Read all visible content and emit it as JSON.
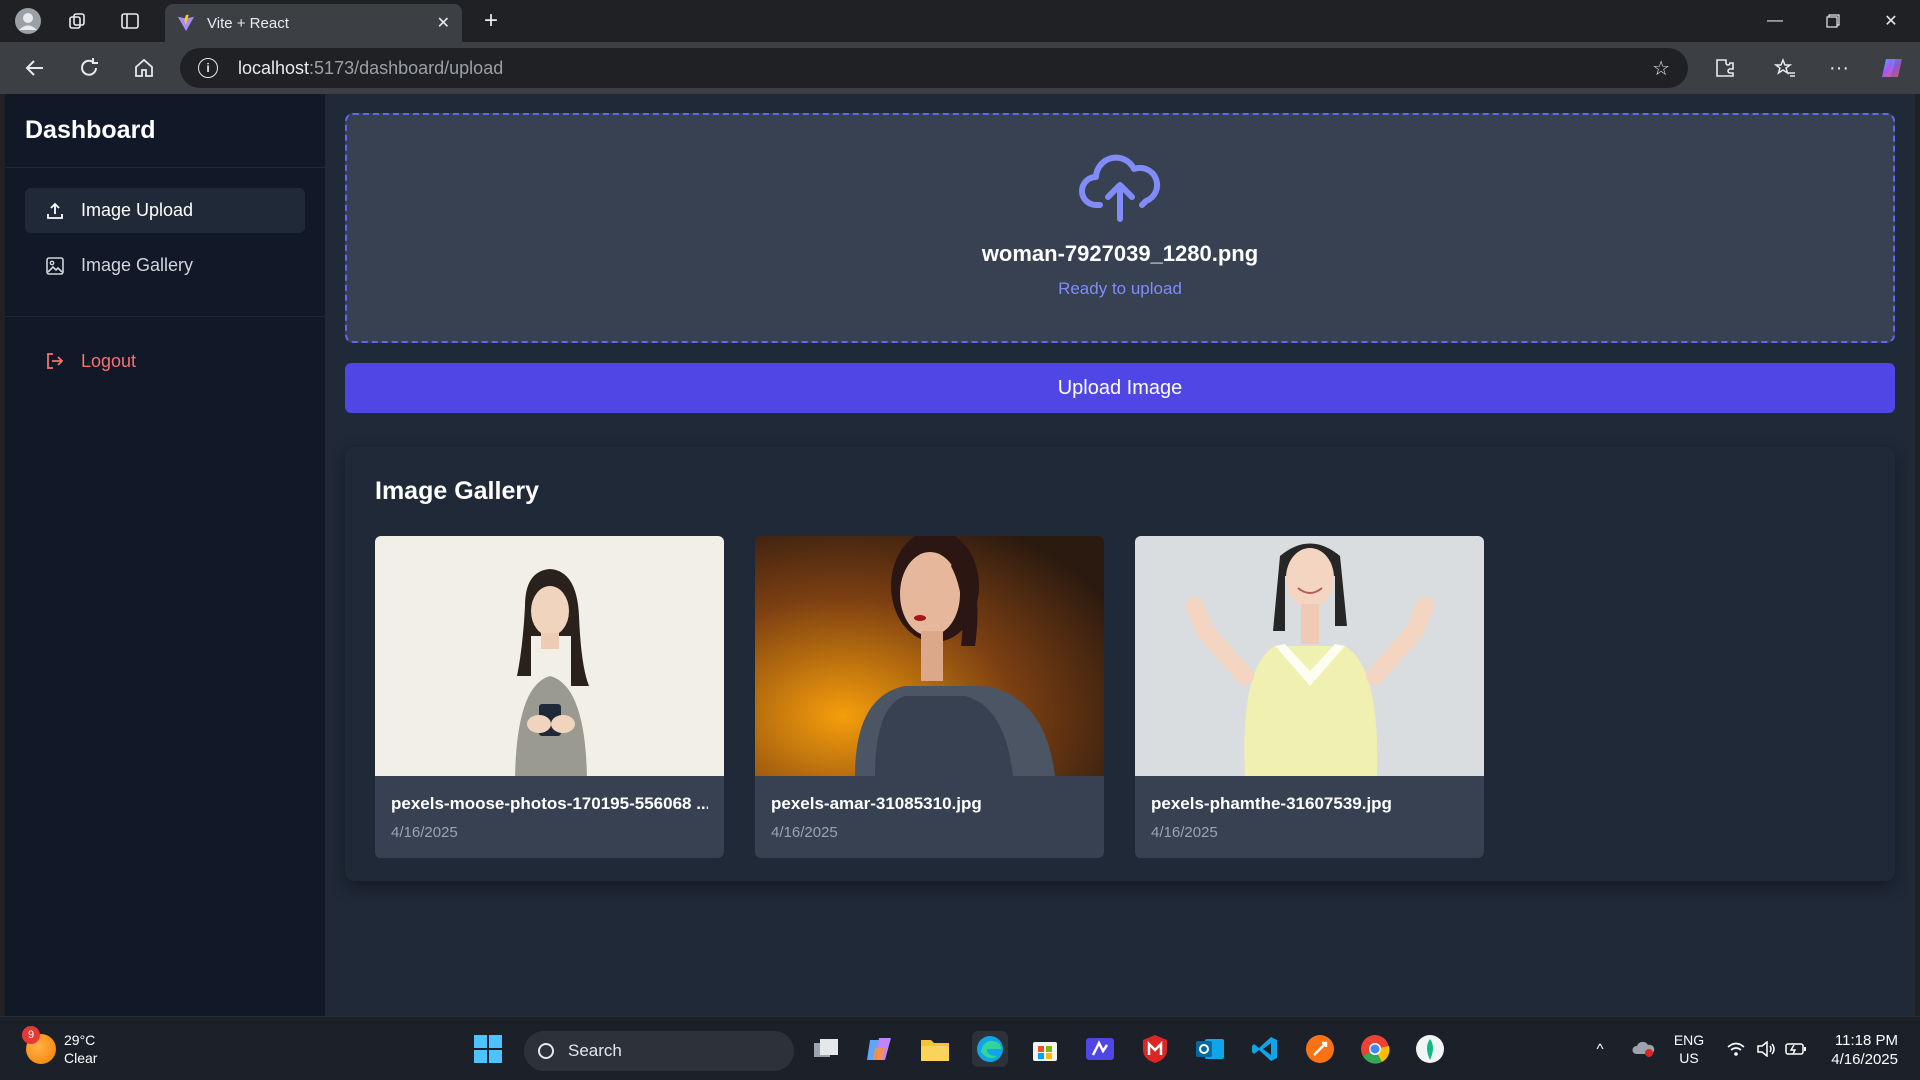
{
  "browser": {
    "tab_title": "Vite + React",
    "url_host": "localhost",
    "url_path": ":5173/dashboard/upload"
  },
  "sidebar": {
    "brand": "Dashboard",
    "items": [
      {
        "label": "Image Upload",
        "icon": "upload-icon",
        "active": true
      },
      {
        "label": "Image Gallery",
        "icon": "image-icon",
        "active": false
      }
    ],
    "logout_label": "Logout"
  },
  "upload": {
    "file_name": "woman-7927039_1280.png",
    "status": "Ready to upload",
    "button_label": "Upload Image"
  },
  "gallery": {
    "title": "Image Gallery",
    "images": [
      {
        "name": "pexels-moose-photos-170195-556068 ...",
        "date": "4/16/2025"
      },
      {
        "name": "pexels-amar-31085310.jpg",
        "date": "4/16/2025"
      },
      {
        "name": "pexels-phamthe-31607539.jpg",
        "date": "4/16/2025"
      }
    ]
  },
  "taskbar": {
    "weather_temp": "29°C",
    "weather_cond": "Clear",
    "weather_badge": "9",
    "search_label": "Search",
    "lang_top": "ENG",
    "lang_bottom": "US",
    "time": "11:18 PM",
    "date": "4/16/2025"
  },
  "colors": {
    "accent": "#4f46e5",
    "accent_light": "#818cf8",
    "sidebar_bg": "#111827",
    "main_bg": "#1f2937",
    "card_bg": "#374151",
    "logout": "#f87171"
  }
}
